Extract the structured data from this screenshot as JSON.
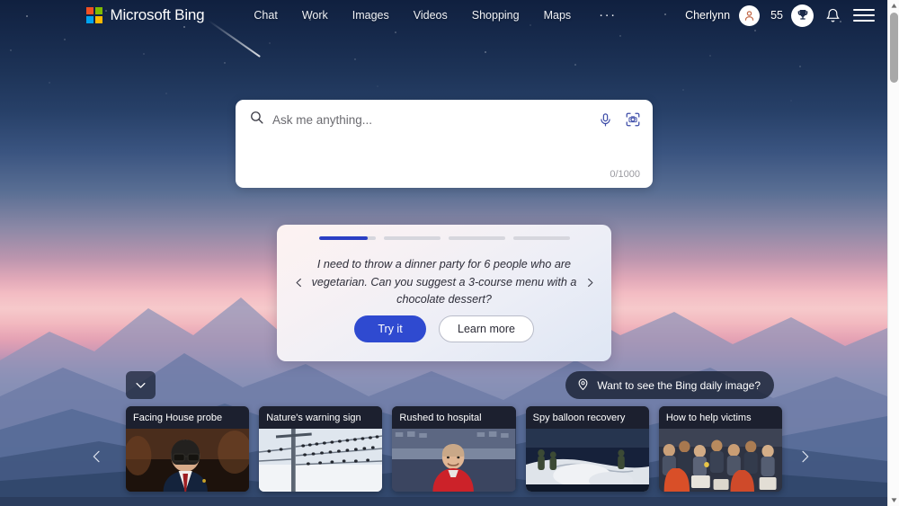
{
  "header": {
    "brand": "Microsoft Bing",
    "logo_icon": "microsoft-logo-icon",
    "nav": [
      {
        "label": "Chat"
      },
      {
        "label": "Work"
      },
      {
        "label": "Images"
      },
      {
        "label": "Videos"
      },
      {
        "label": "Shopping"
      },
      {
        "label": "Maps"
      }
    ],
    "more_label": "···",
    "user_name": "Cherlynn",
    "avatar_icon": "user-avatar-icon",
    "points": "55",
    "rewards_icon": "trophy-icon",
    "notifications_icon": "bell-icon",
    "menu_icon": "hamburger-menu-icon"
  },
  "search": {
    "value": "",
    "placeholder": "Ask me anything...",
    "search_icon": "search-icon",
    "mic_icon": "microphone-icon",
    "visual_search_icon": "camera-visual-search-icon",
    "char_count": "0/1000"
  },
  "suggestion": {
    "progress": [
      {
        "fill_percent": 86
      },
      {
        "fill_percent": 0
      },
      {
        "fill_percent": 0
      },
      {
        "fill_percent": 0
      }
    ],
    "prev_icon": "chevron-left-icon",
    "next_icon": "chevron-right-icon",
    "text": "I need to throw a dinner party for 6 people who are vegetarian. Can you suggest a 3-course menu with a chocolate dessert?",
    "try_label": "Try it",
    "learn_label": "Learn more"
  },
  "daily_image": {
    "label": "Want to see the Bing daily image?",
    "pin_icon": "location-pin-icon"
  },
  "collapse": {
    "icon": "chevron-down-icon"
  },
  "news": {
    "prev_icon": "chevron-left-icon",
    "next_icon": "chevron-right-icon",
    "cards": [
      {
        "title": "Facing House probe",
        "image": "politician-in-hearing-room"
      },
      {
        "title": "Nature's warning sign",
        "image": "birds-on-power-lines"
      },
      {
        "title": "Rushed to hospital",
        "image": "man-in-red-shirt-at-stadium"
      },
      {
        "title": "Spy balloon recovery",
        "image": "navy-crew-recovering-balloon-debris"
      },
      {
        "title": "How to help victims",
        "image": "crowd-of-people-receiving-aid"
      }
    ]
  },
  "scrollbar": {
    "up_icon": "scroll-up-arrow-icon",
    "down_icon": "scroll-down-arrow-icon"
  },
  "colors": {
    "accent_blue": "#2f4ad0",
    "progress_blue": "#2b3fc4",
    "logo_red": "#f25022",
    "logo_green": "#7fba00",
    "logo_blue": "#00a4ef",
    "logo_yellow": "#ffb900"
  }
}
